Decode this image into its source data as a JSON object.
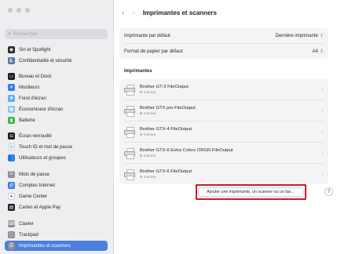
{
  "sidebar": {
    "search_placeholder": "Rechercher",
    "items": [
      {
        "label": "Siri et Spotlight",
        "icon": "siri-icon",
        "color": "#2b2b33",
        "glyph": "◉"
      },
      {
        "label": "Confidentialité et sécurité",
        "icon": "hand-icon",
        "color": "#3a7be0",
        "glyph": "✋"
      },
      {
        "label": "Bureau et Dock",
        "icon": "dock-icon",
        "color": "#1e1e22",
        "glyph": "▭"
      },
      {
        "label": "Moniteurs",
        "icon": "sun-icon",
        "color": "#3a7be0",
        "glyph": "☀"
      },
      {
        "label": "Fond d'écran",
        "icon": "wallpaper-icon",
        "color": "#5ab3f0",
        "glyph": "❋"
      },
      {
        "label": "Économiseur d'écran",
        "icon": "screensaver-icon",
        "color": "#7fc6f2",
        "glyph": "▦"
      },
      {
        "label": "Batterie",
        "icon": "battery-icon",
        "color": "#3fb548",
        "glyph": "▮"
      },
      {
        "label": "Écran verrouillé",
        "icon": "lock-screen-icon",
        "color": "#1e1e22",
        "glyph": "◘"
      },
      {
        "label": "Touch ID et mot de passe",
        "icon": "fingerprint-icon",
        "color": "#ffffff",
        "glyph": "◎"
      },
      {
        "label": "Utilisateurs et groupes",
        "icon": "users-icon",
        "color": "#3a7be0",
        "glyph": "👥"
      },
      {
        "label": "Mots de passe",
        "icon": "key-icon",
        "color": "#8e8e93",
        "glyph": "⚿"
      },
      {
        "label": "Comptes Internet",
        "icon": "at-icon",
        "color": "#3a7be0",
        "glyph": "@"
      },
      {
        "label": "Game Center",
        "icon": "game-center-icon",
        "color": "#ffffff",
        "glyph": "●"
      },
      {
        "label": "Cartes et Apple Pay",
        "icon": "wallet-icon",
        "color": "#1e1e22",
        "glyph": "▤"
      },
      {
        "label": "Clavier",
        "icon": "keyboard-icon",
        "color": "#8e8e93",
        "glyph": "⌨"
      },
      {
        "label": "Trackpad",
        "icon": "trackpad-icon",
        "color": "#8e8e93",
        "glyph": "▢"
      },
      {
        "label": "Imprimantes et scanners",
        "icon": "printer-icon",
        "color": "#8e8e93",
        "glyph": "⎙"
      }
    ]
  },
  "toolbar": {
    "title": "Imprimantes et scanners",
    "back": "‹",
    "forward": "›"
  },
  "settings": {
    "default_printer_label": "Imprimante par défaut",
    "default_printer_value": "Dernière imprimante",
    "paper_size_label": "Format de papier par défaut",
    "paper_size_value": "A4"
  },
  "printers_section": {
    "title": "Imprimantes",
    "items": [
      {
        "name": "Brother GT-3 FileOutput",
        "status": "Inactive"
      },
      {
        "name": "Brother GTX pro FileOutput",
        "status": "Inactive"
      },
      {
        "name": "Brother GTX-4 FileOutput",
        "status": "Inactive"
      },
      {
        "name": "Brother GTX-6 Extra Colors ORGR FileOutput",
        "status": "Inactive"
      },
      {
        "name": "Brother GTX-6 FileOutput",
        "status": "Inactive"
      }
    ]
  },
  "add_button_label": "Ajouter une imprimante, un scanner ou un fax…",
  "help_label": "?",
  "colors": {
    "accent": "#4b7fe0",
    "highlight": "#d0182a"
  }
}
